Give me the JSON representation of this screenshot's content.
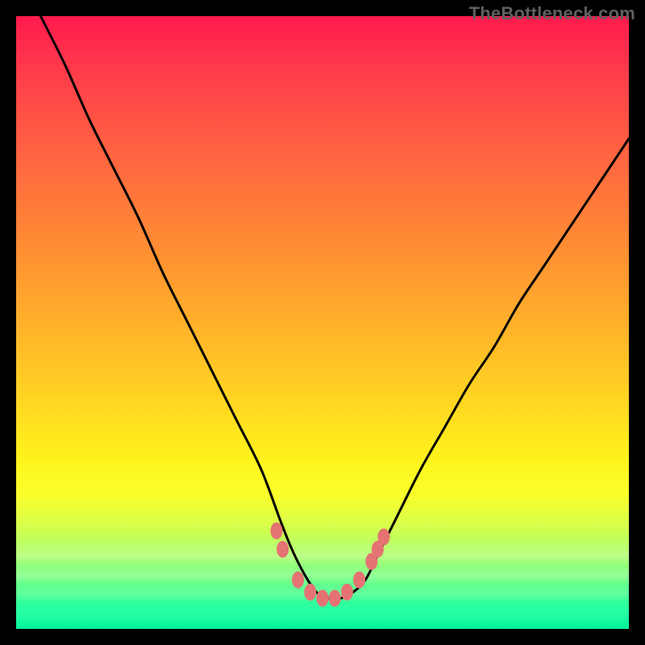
{
  "watermark": "TheBottleneck.com",
  "colors": {
    "frame": "#000000",
    "curve": "#000000",
    "marker": "#e57373",
    "gradient_top": "#ff1a4d",
    "gradient_bottom": "#00f59a"
  },
  "chart_data": {
    "type": "line",
    "title": "",
    "xlabel": "",
    "ylabel": "",
    "xlim": [
      0,
      100
    ],
    "ylim": [
      0,
      100
    ],
    "grid": false,
    "legend": false,
    "series": [
      {
        "name": "bottleneck-curve",
        "x": [
          4,
          8,
          12,
          16,
          20,
          24,
          28,
          32,
          36,
          40,
          43,
          45,
          47,
          49,
          51,
          53,
          55,
          57,
          59,
          62,
          66,
          70,
          74,
          78,
          82,
          86,
          90,
          94,
          98,
          100
        ],
        "y": [
          100,
          92,
          83,
          75,
          67,
          58,
          50,
          42,
          34,
          26,
          18,
          13,
          9,
          6,
          5,
          5,
          6,
          8,
          12,
          18,
          26,
          33,
          40,
          46,
          53,
          59,
          65,
          71,
          77,
          80
        ]
      }
    ],
    "markers": [
      {
        "x": 42.5,
        "y": 16
      },
      {
        "x": 43.5,
        "y": 13
      },
      {
        "x": 46.0,
        "y": 8
      },
      {
        "x": 48.0,
        "y": 6
      },
      {
        "x": 50.0,
        "y": 5
      },
      {
        "x": 52.0,
        "y": 5
      },
      {
        "x": 54.0,
        "y": 6
      },
      {
        "x": 56.0,
        "y": 8
      },
      {
        "x": 58.0,
        "y": 11
      },
      {
        "x": 59.0,
        "y": 13
      },
      {
        "x": 60.0,
        "y": 15
      }
    ]
  }
}
